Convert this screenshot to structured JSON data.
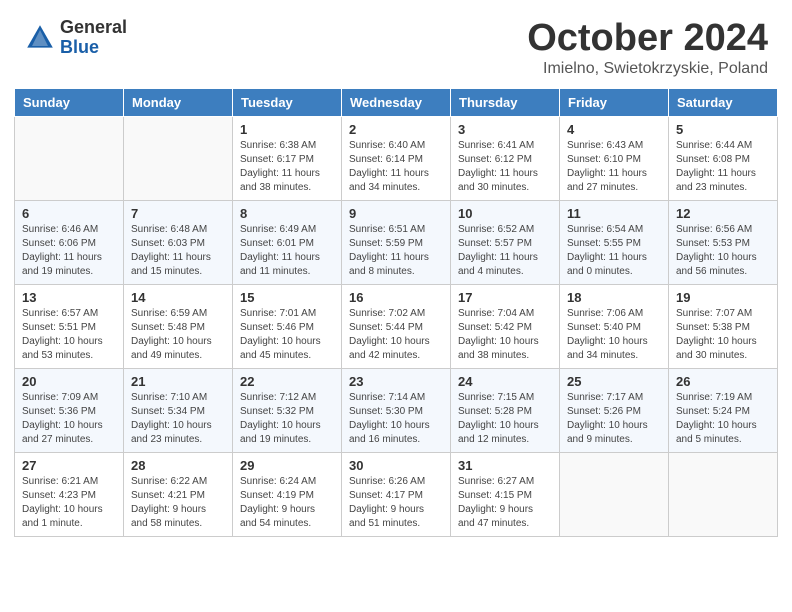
{
  "header": {
    "logo_general": "General",
    "logo_blue": "Blue",
    "month_title": "October 2024",
    "subtitle": "Imielno, Swietokrzyskie, Poland"
  },
  "weekdays": [
    "Sunday",
    "Monday",
    "Tuesday",
    "Wednesday",
    "Thursday",
    "Friday",
    "Saturday"
  ],
  "weeks": [
    [
      {
        "day": "",
        "info": ""
      },
      {
        "day": "",
        "info": ""
      },
      {
        "day": "1",
        "info": "Sunrise: 6:38 AM\nSunset: 6:17 PM\nDaylight: 11 hours\nand 38 minutes."
      },
      {
        "day": "2",
        "info": "Sunrise: 6:40 AM\nSunset: 6:14 PM\nDaylight: 11 hours\nand 34 minutes."
      },
      {
        "day": "3",
        "info": "Sunrise: 6:41 AM\nSunset: 6:12 PM\nDaylight: 11 hours\nand 30 minutes."
      },
      {
        "day": "4",
        "info": "Sunrise: 6:43 AM\nSunset: 6:10 PM\nDaylight: 11 hours\nand 27 minutes."
      },
      {
        "day": "5",
        "info": "Sunrise: 6:44 AM\nSunset: 6:08 PM\nDaylight: 11 hours\nand 23 minutes."
      }
    ],
    [
      {
        "day": "6",
        "info": "Sunrise: 6:46 AM\nSunset: 6:06 PM\nDaylight: 11 hours\nand 19 minutes."
      },
      {
        "day": "7",
        "info": "Sunrise: 6:48 AM\nSunset: 6:03 PM\nDaylight: 11 hours\nand 15 minutes."
      },
      {
        "day": "8",
        "info": "Sunrise: 6:49 AM\nSunset: 6:01 PM\nDaylight: 11 hours\nand 11 minutes."
      },
      {
        "day": "9",
        "info": "Sunrise: 6:51 AM\nSunset: 5:59 PM\nDaylight: 11 hours\nand 8 minutes."
      },
      {
        "day": "10",
        "info": "Sunrise: 6:52 AM\nSunset: 5:57 PM\nDaylight: 11 hours\nand 4 minutes."
      },
      {
        "day": "11",
        "info": "Sunrise: 6:54 AM\nSunset: 5:55 PM\nDaylight: 11 hours\nand 0 minutes."
      },
      {
        "day": "12",
        "info": "Sunrise: 6:56 AM\nSunset: 5:53 PM\nDaylight: 10 hours\nand 56 minutes."
      }
    ],
    [
      {
        "day": "13",
        "info": "Sunrise: 6:57 AM\nSunset: 5:51 PM\nDaylight: 10 hours\nand 53 minutes."
      },
      {
        "day": "14",
        "info": "Sunrise: 6:59 AM\nSunset: 5:48 PM\nDaylight: 10 hours\nand 49 minutes."
      },
      {
        "day": "15",
        "info": "Sunrise: 7:01 AM\nSunset: 5:46 PM\nDaylight: 10 hours\nand 45 minutes."
      },
      {
        "day": "16",
        "info": "Sunrise: 7:02 AM\nSunset: 5:44 PM\nDaylight: 10 hours\nand 42 minutes."
      },
      {
        "day": "17",
        "info": "Sunrise: 7:04 AM\nSunset: 5:42 PM\nDaylight: 10 hours\nand 38 minutes."
      },
      {
        "day": "18",
        "info": "Sunrise: 7:06 AM\nSunset: 5:40 PM\nDaylight: 10 hours\nand 34 minutes."
      },
      {
        "day": "19",
        "info": "Sunrise: 7:07 AM\nSunset: 5:38 PM\nDaylight: 10 hours\nand 30 minutes."
      }
    ],
    [
      {
        "day": "20",
        "info": "Sunrise: 7:09 AM\nSunset: 5:36 PM\nDaylight: 10 hours\nand 27 minutes."
      },
      {
        "day": "21",
        "info": "Sunrise: 7:10 AM\nSunset: 5:34 PM\nDaylight: 10 hours\nand 23 minutes."
      },
      {
        "day": "22",
        "info": "Sunrise: 7:12 AM\nSunset: 5:32 PM\nDaylight: 10 hours\nand 19 minutes."
      },
      {
        "day": "23",
        "info": "Sunrise: 7:14 AM\nSunset: 5:30 PM\nDaylight: 10 hours\nand 16 minutes."
      },
      {
        "day": "24",
        "info": "Sunrise: 7:15 AM\nSunset: 5:28 PM\nDaylight: 10 hours\nand 12 minutes."
      },
      {
        "day": "25",
        "info": "Sunrise: 7:17 AM\nSunset: 5:26 PM\nDaylight: 10 hours\nand 9 minutes."
      },
      {
        "day": "26",
        "info": "Sunrise: 7:19 AM\nSunset: 5:24 PM\nDaylight: 10 hours\nand 5 minutes."
      }
    ],
    [
      {
        "day": "27",
        "info": "Sunrise: 6:21 AM\nSunset: 4:23 PM\nDaylight: 10 hours\nand 1 minute."
      },
      {
        "day": "28",
        "info": "Sunrise: 6:22 AM\nSunset: 4:21 PM\nDaylight: 9 hours\nand 58 minutes."
      },
      {
        "day": "29",
        "info": "Sunrise: 6:24 AM\nSunset: 4:19 PM\nDaylight: 9 hours\nand 54 minutes."
      },
      {
        "day": "30",
        "info": "Sunrise: 6:26 AM\nSunset: 4:17 PM\nDaylight: 9 hours\nand 51 minutes."
      },
      {
        "day": "31",
        "info": "Sunrise: 6:27 AM\nSunset: 4:15 PM\nDaylight: 9 hours\nand 47 minutes."
      },
      {
        "day": "",
        "info": ""
      },
      {
        "day": "",
        "info": ""
      }
    ]
  ]
}
